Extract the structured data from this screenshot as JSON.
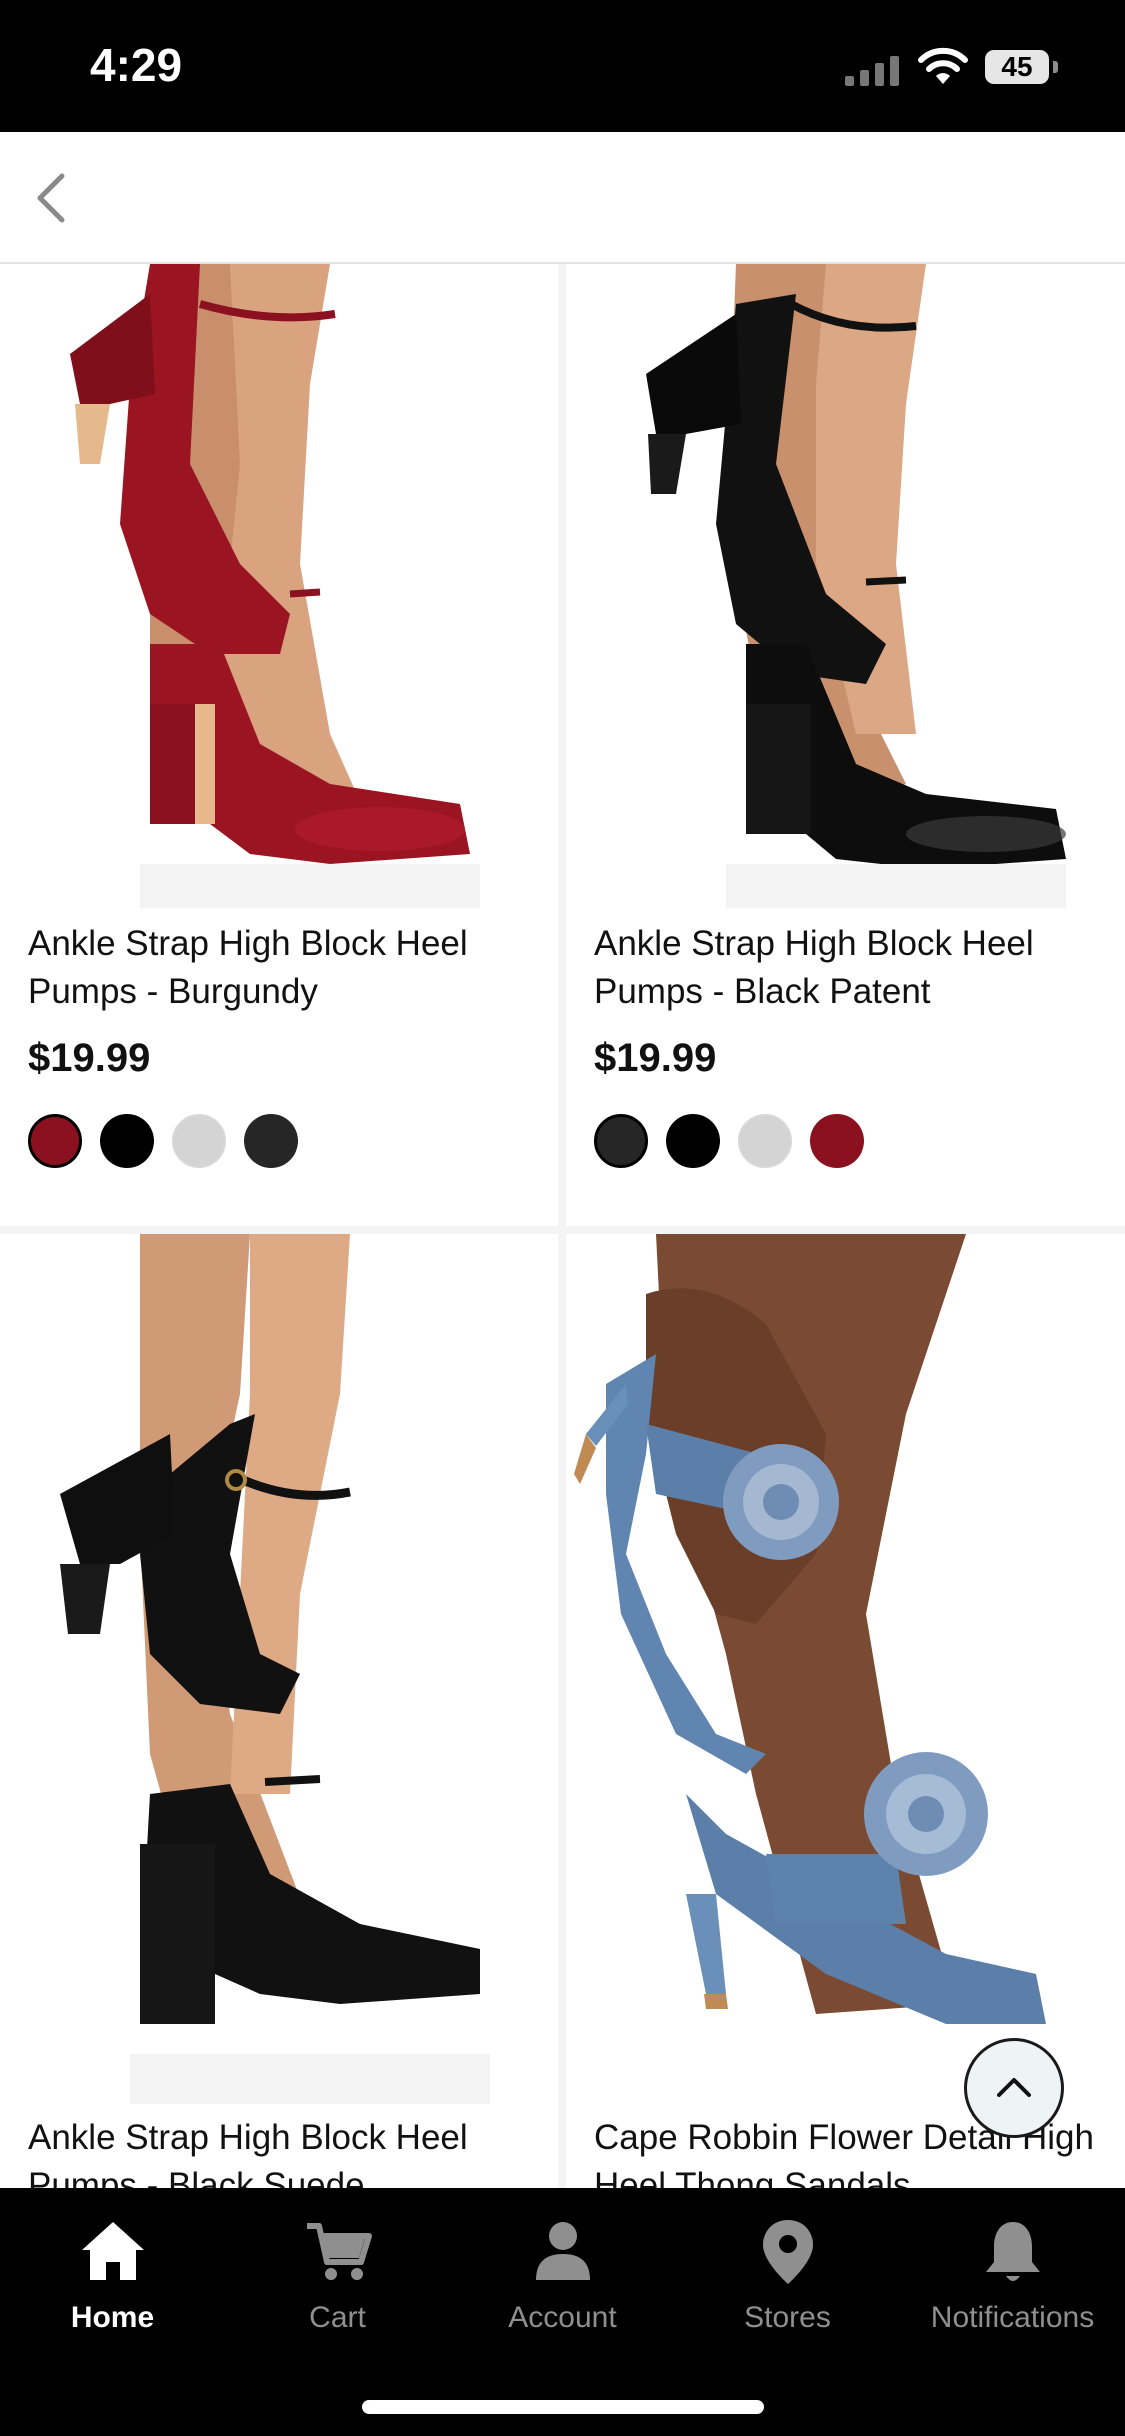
{
  "status_bar": {
    "time": "4:29",
    "battery": "45"
  },
  "products": [
    {
      "title": "Ankle Strap High Block Heel Pumps - Burgundy",
      "price": "$19.99",
      "image": "burgundy-patent-pumps",
      "swatches": [
        "#8b1020",
        "#000000",
        "#d4d4d4",
        "#262626"
      ],
      "selected_swatch": 0
    },
    {
      "title": "Ankle Strap High Block Heel Pumps - Black Patent",
      "price": "$19.99",
      "image": "black-patent-pumps",
      "swatches": [
        "#262626",
        "#000000",
        "#d4d4d4",
        "#8b1020"
      ],
      "selected_swatch": 0
    },
    {
      "title": "Ankle Strap High Block Heel Pumps - Black Suede",
      "price": "",
      "image": "black-suede-pumps"
    },
    {
      "title": "Cape Robbin Flower Detail High Heel Thong Sandals",
      "price": "",
      "image": "denim-flower-sandals"
    }
  ],
  "tabs": [
    {
      "label": "Home",
      "icon": "home-icon",
      "active": true
    },
    {
      "label": "Cart",
      "icon": "cart-icon",
      "active": false
    },
    {
      "label": "Account",
      "icon": "account-icon",
      "active": false
    },
    {
      "label": "Stores",
      "icon": "location-pin-icon",
      "active": false
    },
    {
      "label": "Notifications",
      "icon": "bell-icon",
      "active": false
    }
  ],
  "colors": {
    "burgundy": "#8b1020",
    "black": "#000000",
    "denim": "#5b7fa8",
    "skin": "#d7a07b"
  }
}
